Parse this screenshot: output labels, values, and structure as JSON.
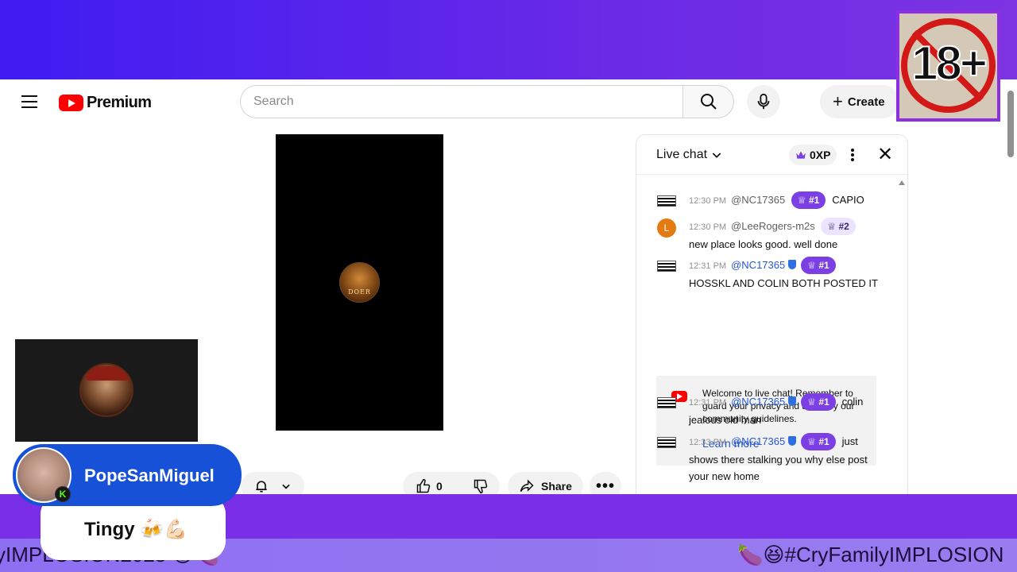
{
  "header": {
    "brand": "Premium",
    "search_placeholder": "Search",
    "create_label": "Create"
  },
  "video": {
    "logo_text": "DOER"
  },
  "actions": {
    "like_count": "0",
    "share_label": "Share"
  },
  "chat": {
    "title": "Live chat",
    "xp": "0XP",
    "messages": [
      {
        "time": "12:30 PM",
        "author": "@NC17365",
        "rank": "#1",
        "text": "CAPIO"
      },
      {
        "time": "12:30 PM",
        "author": "@LeeRogers-m2s",
        "avatar_letter": "L",
        "rank": "#2",
        "text": "new place looks good. well done"
      },
      {
        "time": "12:31 PM",
        "author": "@NC17365",
        "rank": "#1",
        "text": "HOSSKL AND COLIN BOTH POSTED IT"
      },
      {
        "time": "12:31 PM",
        "author": "@NC17365",
        "rank": "#1",
        "text": "colin jealous old man"
      },
      {
        "time": "12:33 PM",
        "author": "@NC17365",
        "rank": "#1",
        "text": "just shows there stalking you why else post your new home"
      }
    ],
    "welcome": {
      "text": "Welcome to live chat! Remember to guard your privacy and abide by our community guidelines.",
      "link": "Learn more"
    }
  },
  "overlay": {
    "age_rating": "18+",
    "streamer_name": "PopeSanMiguel",
    "kick_badge": "K",
    "streamer_message": "Tingy 🍻💪🏻",
    "ticker_left": "yIMPLOSION2025 😆🍆",
    "ticker_right": "🍆😆#CryFamilyIMPLOSION"
  }
}
